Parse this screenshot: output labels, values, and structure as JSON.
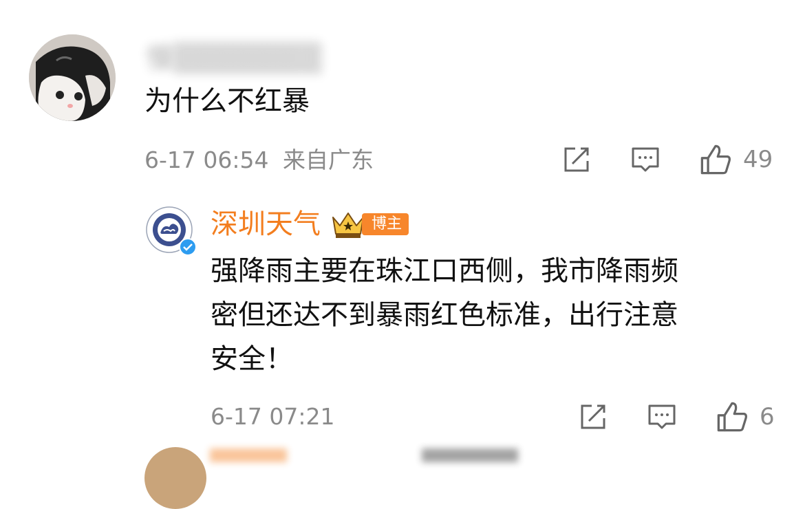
{
  "comment": {
    "username": "慢",
    "text": "为什么不红暴",
    "timestamp": "6-17 06:54",
    "location": "来自广东",
    "like_count": "49"
  },
  "reply": {
    "username": "深圳天气",
    "badge": "博主",
    "text_lines": [
      "强降雨主要在珠江口西侧，我市降雨频",
      "密但还达不到暴雨红色标准，出行注意",
      "安全！"
    ],
    "timestamp": "6-17 07:21",
    "like_count": "6"
  },
  "icons": {
    "forward": "share-forward-icon",
    "comment": "comment-icon",
    "like": "thumbs-up-icon",
    "verified": "verified-check-icon",
    "crown": "crown-icon"
  },
  "colors": {
    "accent": "#f37e1f",
    "verified": "#2d9cf0",
    "meta": "#8a8a8a"
  }
}
